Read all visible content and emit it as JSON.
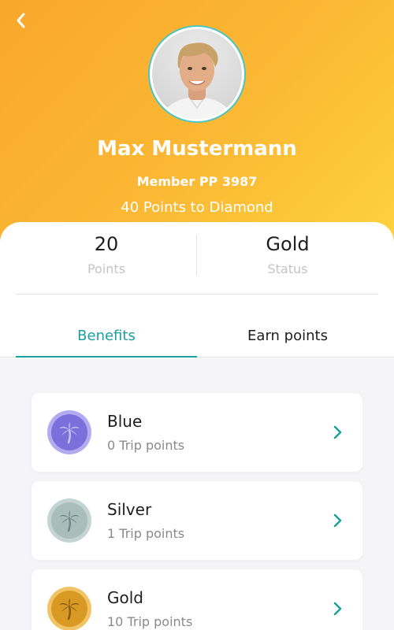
{
  "header": {
    "name": "Max Mustermann",
    "member": "Member PP 3987",
    "points_to_next": "40 Points to Diamond"
  },
  "stats": {
    "points_value": "20",
    "points_label": "Points",
    "status_value": "Gold",
    "status_label": "Status"
  },
  "tabs": {
    "benefits": "Benefits",
    "earn": "Earn points",
    "active": "benefits"
  },
  "tiers": [
    {
      "name": "Blue",
      "sub": "0 Trip points",
      "color": "#7b6fdc",
      "ring": "#b3aaf0",
      "icon": "palm-tree-icon"
    },
    {
      "name": "Silver",
      "sub": "1 Trip points",
      "color": "#8fa9a6",
      "ring": "#c4d4d2",
      "icon": "palm-tree-icon"
    },
    {
      "name": "Gold",
      "sub": "10 Trip points",
      "color": "#d99a24",
      "ring": "#f0c366",
      "icon": "palm-tree-icon"
    }
  ],
  "colors": {
    "accent": "#1aa0a0",
    "header_start": "#f9a72b",
    "header_end": "#fdd33f"
  }
}
